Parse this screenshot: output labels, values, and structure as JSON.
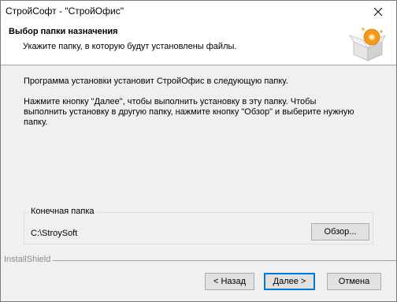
{
  "window": {
    "title": "СтройСофт - \"СтройОфис\""
  },
  "header": {
    "title": "Выбор папки назначения",
    "subtitle": "Укажите папку, в которую будут установлены файлы."
  },
  "body": {
    "line1": "Программа установки установит СтройОфис в следующую папку.",
    "para2_line1": "Нажмите кнопку \"Далее\", чтобы выполнить установку в эту папку. Чтобы",
    "para2_line2": "выполнить установку в другую папку, нажмите кнопку \"Обзор\" и выберите нужную",
    "para2_line3": "папку."
  },
  "destination": {
    "label": "Конечная папка",
    "path": "C:\\StroySoft",
    "browse_label": "Обзор..."
  },
  "footer": {
    "brand": "InstallShield",
    "back_label": "< Назад",
    "next_label": "Далее >",
    "cancel_label": "Отмена"
  },
  "colors": {
    "accent": "#0078d7",
    "background": "#f0f0f0"
  }
}
